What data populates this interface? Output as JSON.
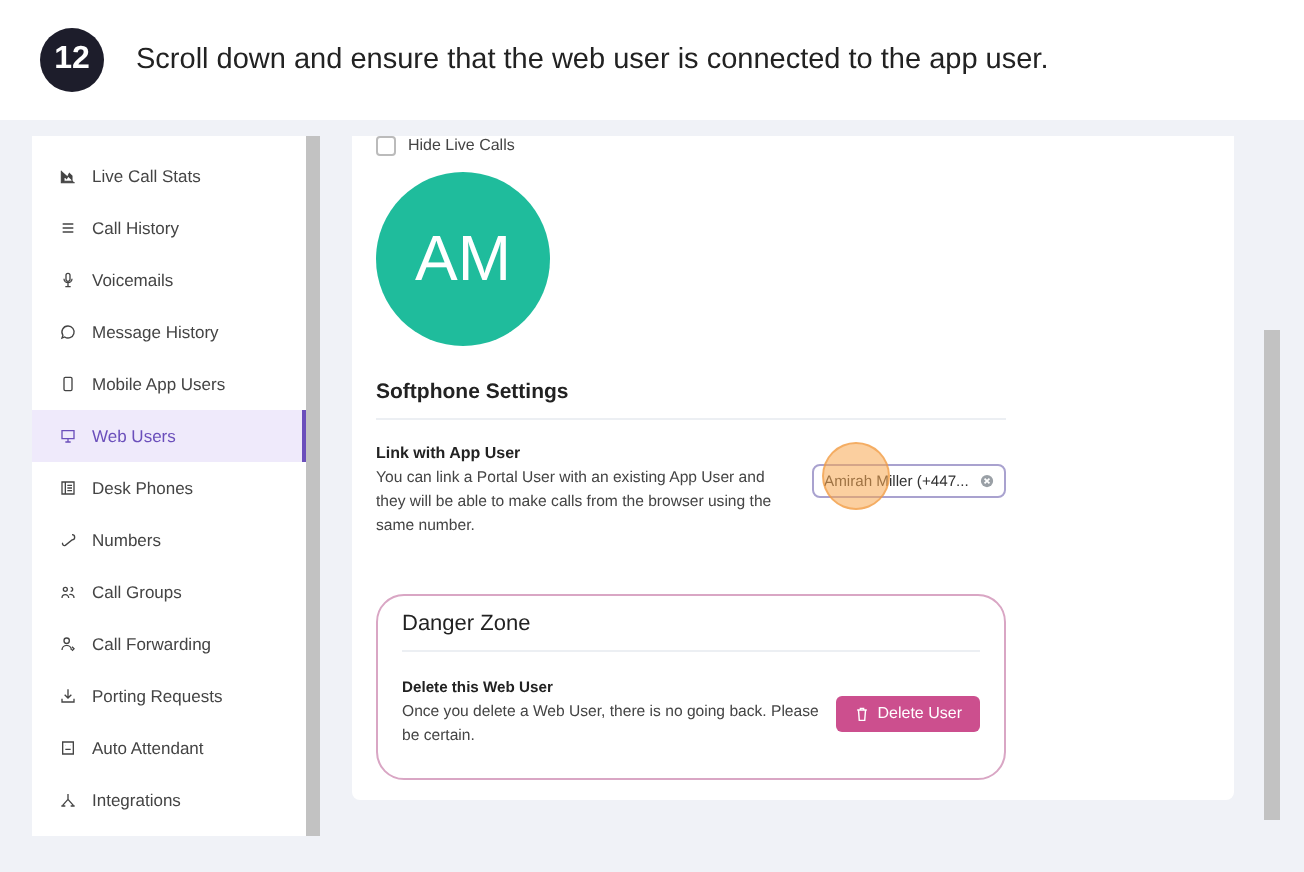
{
  "step": {
    "number": "12",
    "text": "Scroll down and ensure that the web user is connected to the app user."
  },
  "sidebar": {
    "items": [
      {
        "label": "Live Call Stats",
        "selected": false
      },
      {
        "label": "Call History",
        "selected": false
      },
      {
        "label": "Voicemails",
        "selected": false
      },
      {
        "label": "Message History",
        "selected": false
      },
      {
        "label": "Mobile App Users",
        "selected": false
      },
      {
        "label": "Web Users",
        "selected": true
      },
      {
        "label": "Desk Phones",
        "selected": false
      },
      {
        "label": "Numbers",
        "selected": false
      },
      {
        "label": "Call Groups",
        "selected": false
      },
      {
        "label": "Call Forwarding",
        "selected": false
      },
      {
        "label": "Porting Requests",
        "selected": false
      },
      {
        "label": "Auto Attendant",
        "selected": false
      },
      {
        "label": "Integrations",
        "selected": false
      }
    ]
  },
  "main": {
    "hide_live_calls": {
      "label": "Hide Live Calls",
      "checked": false
    },
    "avatar": {
      "initials": "AM"
    },
    "section_title": "Softphone Settings",
    "link": {
      "title": "Link with App User",
      "description": "You can link a Portal User with an existing App User and they will be able to make calls from the browser using the same number.",
      "value": "Amirah Miller (+447..."
    },
    "danger_zone": {
      "title": "Danger Zone",
      "subtitle": "Delete this Web User",
      "description": "Once you delete a Web User, there is no going back. Please be certain.",
      "button": "Delete User"
    }
  }
}
